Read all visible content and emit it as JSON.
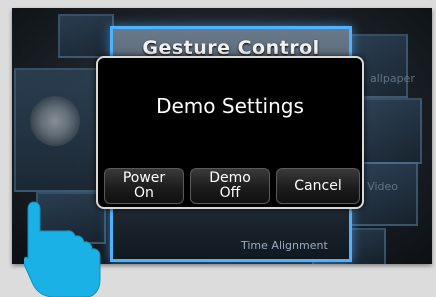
{
  "background": {
    "title": "Gesture Control",
    "tile_labels": {
      "wallpaper": "allpaper",
      "video": "/ Video",
      "time_alignment": "Time Alignment"
    }
  },
  "dialog": {
    "title": "Demo Settings",
    "buttons": {
      "power_on": {
        "line1": "Power",
        "line2": "On"
      },
      "demo_off": {
        "line1": "Demo",
        "line2": "Off"
      },
      "cancel": "Cancel"
    }
  },
  "colors": {
    "dialog_bg": "#000000",
    "dialog_border": "#d8d8d8",
    "panel_border": "#4fb2ff",
    "hand": "#1ab2e6"
  },
  "icons": {
    "hand": "pointing-hand-icon"
  }
}
